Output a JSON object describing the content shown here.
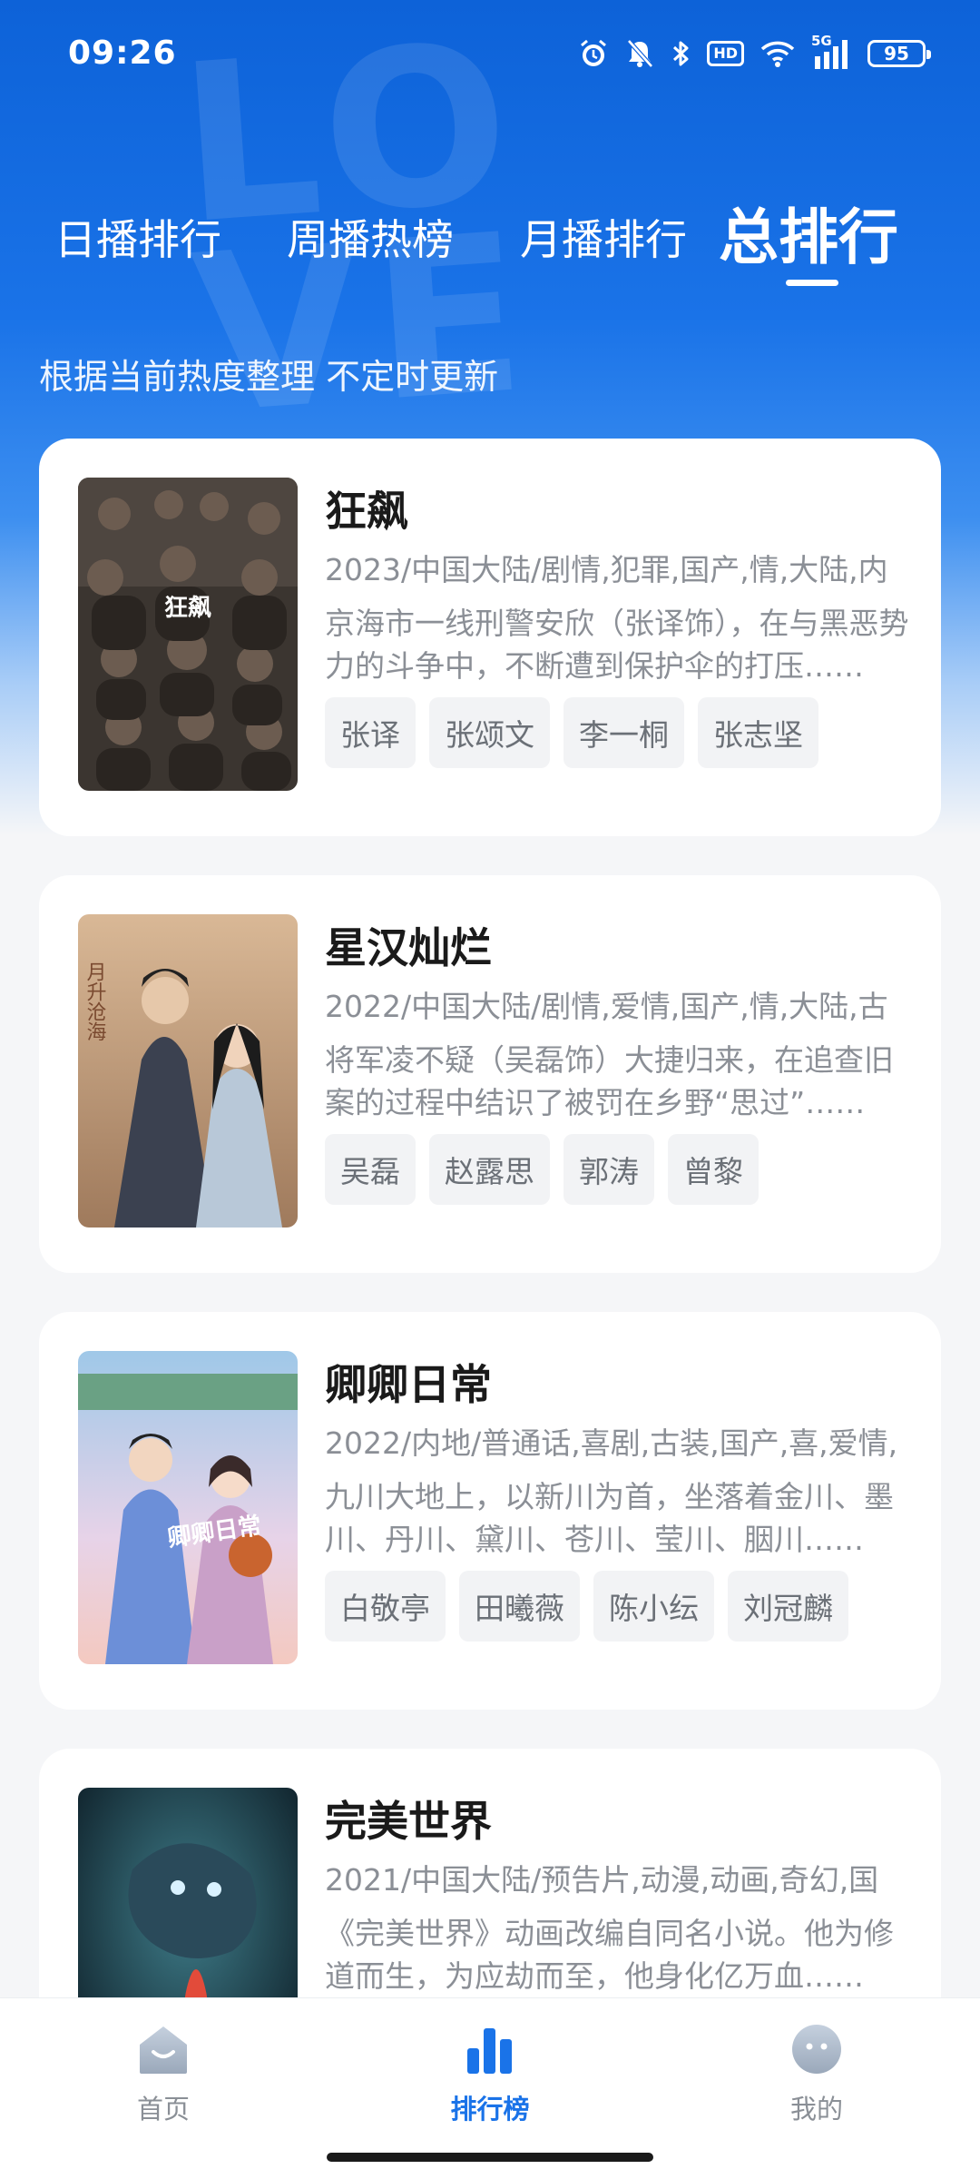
{
  "status_bar": {
    "time": "09:26",
    "battery": "95",
    "hd_label": "HD",
    "signal_label": "5G",
    "icons": [
      "alarm-icon",
      "mute-bell-icon",
      "bluetooth-icon",
      "hd-icon",
      "wifi-icon",
      "signal-icon",
      "battery-icon"
    ]
  },
  "tabs": [
    {
      "label": "日播排行",
      "active": false
    },
    {
      "label": "周播热榜",
      "active": false
    },
    {
      "label": "月播排行",
      "active": false
    },
    {
      "label": "总排行",
      "active": true
    }
  ],
  "subtitle": "根据当前热度整理 不定时更新",
  "shows": [
    {
      "title": "狂飙",
      "meta": "2023/中国大陆/剧情,犯罪,国产,情,大陆,内",
      "desc": "京海市一线刑警安欣（张译饰），在与黑恶势力的斗争中，不断遭到保护伞的打压……",
      "cast": [
        "张译",
        "张颂文",
        "李一桐",
        "张志坚"
      ],
      "poster_text": "狂飙"
    },
    {
      "title": "星汉灿烂",
      "meta": "2022/中国大陆/剧情,爱情,国产,情,大陆,古",
      "desc": "将军凌不疑（吴磊饰）大捷归来，在追查旧案的过程中结识了被罚在乡野“思过”……",
      "cast": [
        "吴磊",
        "赵露思",
        "郭涛",
        "曾黎"
      ],
      "poster_text": "月升沧海"
    },
    {
      "title": "卿卿日常",
      "meta": "2022/内地/普通话,喜剧,古装,国产,喜,爱情,",
      "desc": "九川大地上，以新川为首，坐落着金川、墨川、丹川、黛川、苍川、莹川、胭川……",
      "cast": [
        "白敬亭",
        "田曦薇",
        "陈小纭",
        "刘冠麟"
      ],
      "poster_text": "卿卿日常"
    },
    {
      "title": "完美世界",
      "meta": "2021/中国大陆/预告片,动漫,动画,奇幻,国",
      "desc": "《完美世界》动画改编自同名小说。他为修道而生，为应劫而至，他身化亿万血……",
      "cast": [],
      "poster_text": ""
    }
  ],
  "bottom_nav": [
    {
      "label": "首页",
      "icon": "home-icon",
      "active": false
    },
    {
      "label": "排行榜",
      "icon": "ranking-icon",
      "active": true
    },
    {
      "label": "我的",
      "icon": "profile-icon",
      "active": false
    }
  ],
  "colors": {
    "accent": "#1a73e8",
    "hero_top": "#0d62d8",
    "background": "#f5f6f8",
    "muted_text": "#8b8f96"
  }
}
